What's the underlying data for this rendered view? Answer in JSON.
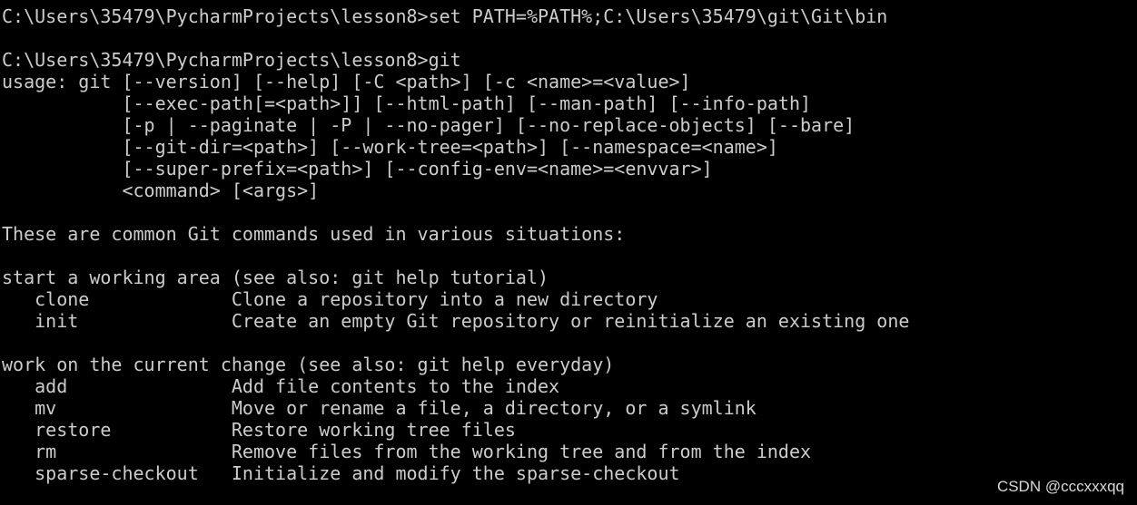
{
  "console": {
    "lines": [
      "C:\\Users\\35479\\PycharmProjects\\lesson8>set PATH=%PATH%;C:\\Users\\35479\\git\\Git\\bin",
      "",
      "C:\\Users\\35479\\PycharmProjects\\lesson8>git",
      "usage: git [--version] [--help] [-C <path>] [-c <name>=<value>]",
      "           [--exec-path[=<path>]] [--html-path] [--man-path] [--info-path]",
      "           [-p | --paginate | -P | --no-pager] [--no-replace-objects] [--bare]",
      "           [--git-dir=<path>] [--work-tree=<path>] [--namespace=<name>]",
      "           [--super-prefix=<path>] [--config-env=<name>=<envvar>]",
      "           <command> [<args>]",
      "",
      "These are common Git commands used in various situations:",
      "",
      "start a working area (see also: git help tutorial)",
      "   clone             Clone a repository into a new directory",
      "   init              Create an empty Git repository or reinitialize an existing one",
      "",
      "work on the current change (see also: git help everyday)",
      "   add               Add file contents to the index",
      "   mv                Move or rename a file, a directory, or a symlink",
      "   restore           Restore working tree files",
      "   rm                Remove files from the working tree and from the index",
      "   sparse-checkout   Initialize and modify the sparse-checkout"
    ]
  },
  "watermark": "CSDN @cccxxxqq",
  "colors": {
    "background": "#000000",
    "text": "#cccccc"
  }
}
